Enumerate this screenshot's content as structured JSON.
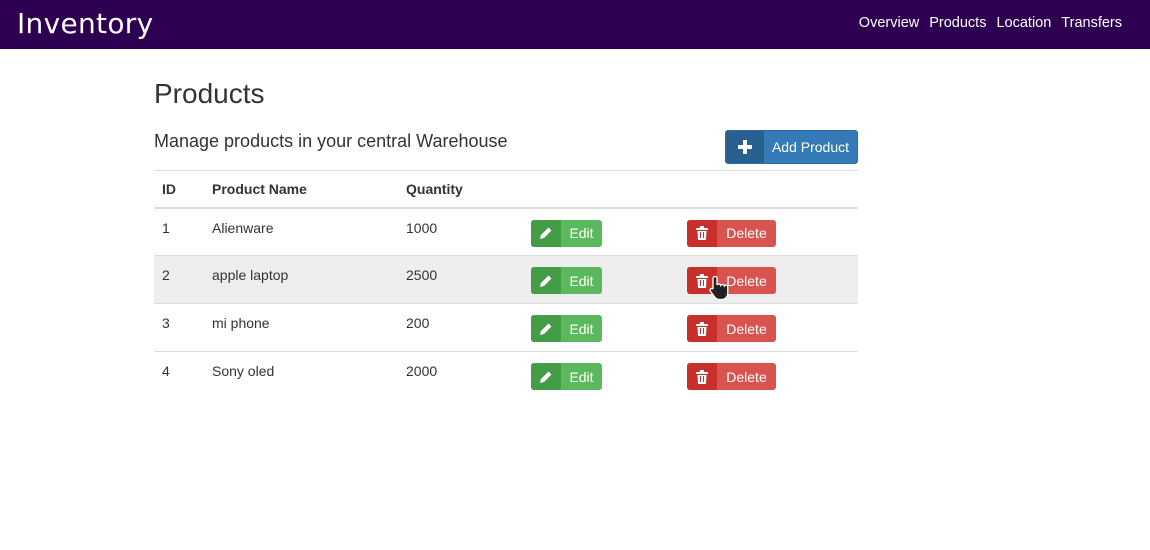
{
  "navbar": {
    "brand": "Inventory",
    "links": [
      {
        "label": "Overview"
      },
      {
        "label": "Products"
      },
      {
        "label": "Location"
      },
      {
        "label": "Transfers"
      }
    ]
  },
  "page": {
    "title": "Products",
    "subtitle": "Manage products in your central Warehouse",
    "add_button_label": "Add Product",
    "add_button_icon": "plus-icon"
  },
  "table": {
    "headers": {
      "id": "ID",
      "name": "Product Name",
      "quantity": "Quantity"
    },
    "rows": [
      {
        "id": "1",
        "name": "Alienware",
        "quantity": "1000",
        "edit_label": "Edit",
        "delete_label": "Delete"
      },
      {
        "id": "2",
        "name": "apple laptop",
        "quantity": "2500",
        "edit_label": "Edit",
        "delete_label": "Delete"
      },
      {
        "id": "3",
        "name": "mi phone",
        "quantity": "200",
        "edit_label": "Edit",
        "delete_label": "Delete"
      },
      {
        "id": "4",
        "name": "Sony oled",
        "quantity": "2000",
        "edit_label": "Edit",
        "delete_label": "Delete"
      }
    ],
    "hovered_row": 2
  },
  "colors": {
    "navbar_bg": "#2e0052",
    "primary": "#337ab7",
    "success": "#5cb85c",
    "danger": "#d9534f"
  },
  "icons": {
    "edit": "pencil-icon",
    "delete": "trash-icon",
    "cursor": "hand-pointer-icon"
  }
}
